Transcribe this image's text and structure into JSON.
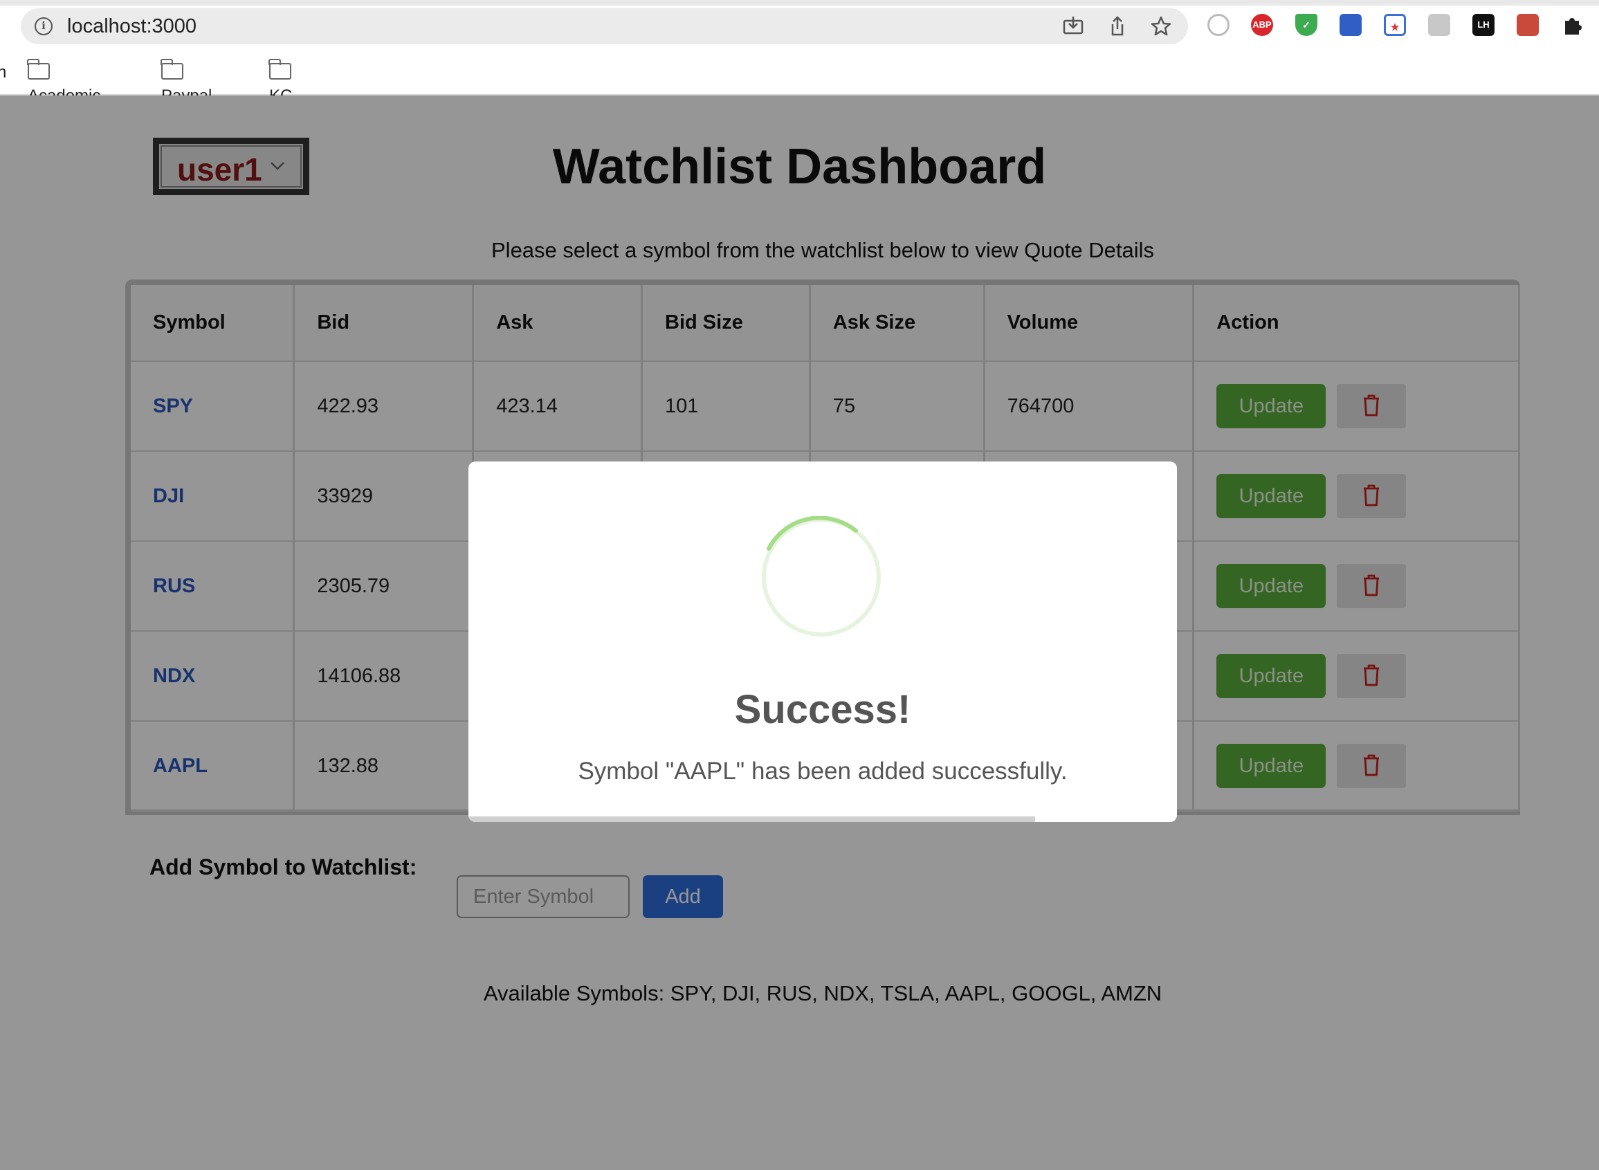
{
  "browser": {
    "url": "localhost:3000",
    "bookmarks": [
      {
        "label": "n"
      },
      {
        "label": "Academic"
      },
      {
        "label": "Paypal"
      },
      {
        "label": "KC"
      }
    ],
    "extensions": [
      "camera-ext-icon",
      "abp-icon",
      "shield-ext-icon",
      "save-ext-icon",
      "bookmark-ext-icon",
      "figure-ext-icon",
      "lh-ext-icon",
      "bug-ext-icon",
      "puzzle-icon"
    ],
    "extension_labels": {
      "abp": "ABP",
      "lh": "LH"
    }
  },
  "header": {
    "user_select": "user1",
    "title": "Watchlist Dashboard",
    "instruction": "Please select a symbol from the watchlist below to view Quote Details"
  },
  "table": {
    "columns": [
      "Symbol",
      "Bid",
      "Ask",
      "Bid Size",
      "Ask Size",
      "Volume",
      "Action"
    ],
    "rows": [
      {
        "symbol": "SPY",
        "bid": "422.93",
        "ask": "423.14",
        "bid_size": "101",
        "ask_size": "75",
        "volume": "764700"
      },
      {
        "symbol": "DJI",
        "bid": "33929",
        "ask": "",
        "bid_size": "",
        "ask_size": "",
        "volume": ""
      },
      {
        "symbol": "RUS",
        "bid": "2305.79",
        "ask": "",
        "bid_size": "",
        "ask_size": "",
        "volume": ""
      },
      {
        "symbol": "NDX",
        "bid": "14106.88",
        "ask": "",
        "bid_size": "",
        "ask_size": "",
        "volume": ""
      },
      {
        "symbol": "AAPL",
        "bid": "132.88",
        "ask": "",
        "bid_size": "",
        "ask_size": "",
        "volume": ""
      }
    ],
    "update_label": "Update"
  },
  "add_form": {
    "label": "Add Symbol to Watchlist:",
    "placeholder": "Enter Symbol",
    "button": "Add"
  },
  "available": "Available Symbols: SPY, DJI, RUS, NDX, TSLA, AAPL, GOOGL, AMZN",
  "modal": {
    "title": "Success!",
    "message": "Symbol \"AAPL\" has been added successfully.",
    "timer_progress": 0.8
  },
  "colors": {
    "update_green": "#5aac3c",
    "add_blue": "#2f6ddd",
    "symbol_blue": "#2855b8",
    "user_red": "#8a1a1a",
    "trash_red": "#c8201c",
    "spinner_green": "#a5dc86"
  }
}
